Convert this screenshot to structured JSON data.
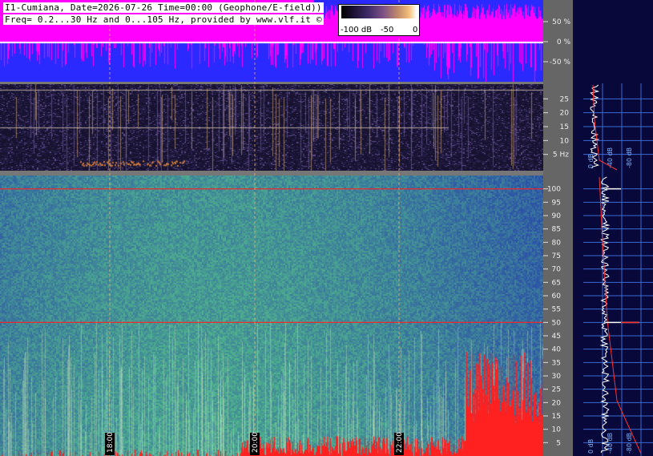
{
  "title": {
    "line1": "I1-Cumiana, Date=2026-07-26 Time=00:00 (Geophone/E-field))",
    "line2": "Freq= 0.2...30 Hz and 0...105 Hz, provided by www.vlf.it ©"
  },
  "colorbar": {
    "labels": [
      "-100 dB",
      "-50",
      "0"
    ]
  },
  "colors": {
    "amplitude_bg": "#ff00ff",
    "amplitude_fill": "#2a2aff",
    "panel_bg": "#0a0a3a",
    "accent_red": "#ff2020",
    "grid_blue": "#3a6bd6"
  },
  "chart_data": [
    {
      "type": "area",
      "panel": "amplitude",
      "ylabel_ticks": [
        "50 %",
        "0 %",
        "-50 %"
      ],
      "yticks": [
        50,
        0,
        -50
      ],
      "ylim": [
        -100,
        100
      ]
    },
    {
      "type": "heatmap",
      "panel": "spectrogram-low",
      "yticks": [
        "25",
        "20",
        "15",
        "10",
        "5 Hz"
      ],
      "ytick_values": [
        25,
        20,
        15,
        10,
        5
      ],
      "ylim": [
        0.2,
        30
      ]
    },
    {
      "type": "heatmap",
      "panel": "spectrogram-high",
      "yticks": [
        "100",
        "95",
        "90",
        "85",
        "80",
        "75",
        "70",
        "65",
        "60",
        "55",
        "50",
        "45",
        "40",
        "35",
        "30",
        "25",
        "20",
        "15",
        "10",
        "5"
      ],
      "ytick_values": [
        100,
        95,
        90,
        85,
        80,
        75,
        70,
        65,
        60,
        55,
        50,
        45,
        40,
        35,
        30,
        25,
        20,
        15,
        10,
        5
      ],
      "ylim": [
        0,
        105
      ],
      "time_labels": [
        "18:00",
        "20:00",
        "22:00"
      ],
      "lines_hz": [
        100,
        50
      ]
    },
    {
      "type": "line",
      "panel": "side-spectrum-low",
      "x_ticks": [
        "0 dB",
        "-40 dB",
        "-80 dB"
      ],
      "xtick_values": [
        0,
        -40,
        -80
      ]
    },
    {
      "type": "line",
      "panel": "side-spectrum-high",
      "x_ticks": [
        "0 dB",
        "-40 dB",
        "-80 dB"
      ],
      "xtick_values": [
        0,
        -40,
        -80
      ]
    }
  ]
}
